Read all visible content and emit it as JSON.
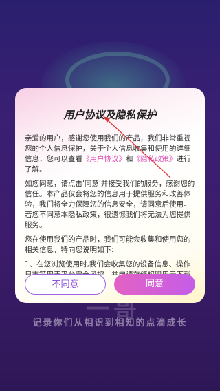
{
  "background": {
    "logo_text": "一哥",
    "slogan": "记录你们从相识到相知的点滴成长"
  },
  "dialog": {
    "title": "用户协议及隐私保护",
    "para1_before": "亲爱的用户，感谢您使用我们的产品，我们非常重视您的个人信息保护，关于个人信息收集和使用的详细信息，您可以查看",
    "link_user_agreement": "《用户协议》",
    "and": "和",
    "link_privacy_policy": "《隐私政策》",
    "para1_after": "进行了解。",
    "para2": "如您同意，请点击'同意'并接受我们的服务，感谢您的信任。本产品仅会将您的信息用于提供服务和改善体验，我们将全力保障您的信息安全，请同意后使用。若您不同意本隐私政策，很遗憾我们将无法为您提供服务。",
    "para3": "您在使用我们的产品时，我们可能会收集和使用您的相关信息，特向您说明如下:",
    "para4": "1、在您浏览使用时,我们会收集您的设备信息、操作日志等用于平台安全风控，并申请存储权限用于下载及缓存相关文件。",
    "disagree_label": "不同意",
    "agree_label": "同意"
  },
  "colors": {
    "accent": "#e04cb4",
    "agree_gradient_start": "#e262c3",
    "agree_gradient_end": "#c55de8",
    "disagree_border": "#9d63e0"
  }
}
